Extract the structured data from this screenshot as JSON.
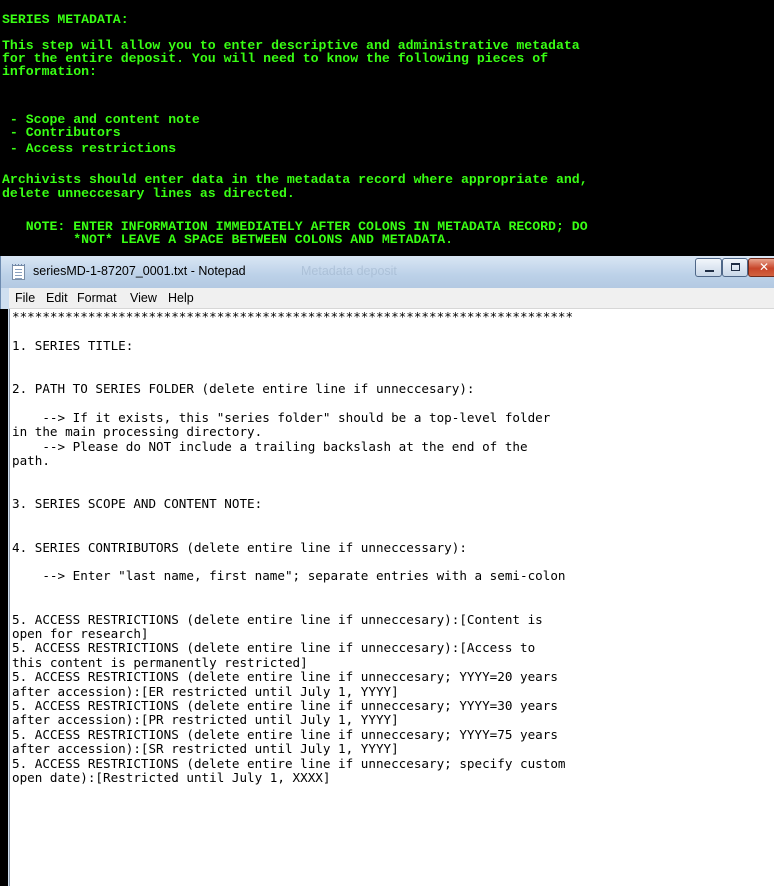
{
  "console": {
    "lines": [
      "SERIES METADATA:",
      "This step will allow you to enter descriptive and administrative metadata",
      "for the entire deposit. You will need to know the following pieces of",
      "information:",
      " - Scope and content note",
      " - Contributors",
      " - Access restrictions",
      "Archivists should enter data in the metadata record where appropriate and,",
      "delete unneccesary lines as directed.",
      "   NOTE: ENTER INFORMATION IMMEDIATELY AFTER COLONS IN METADATA RECORD; DO",
      "         *NOT* LEAVE A SPACE BETWEEN COLONS AND METADATA."
    ]
  },
  "window": {
    "title": "seriesMD-1-87207_0001.txt - Notepad",
    "background_title": "Metadata deposit",
    "colors": {
      "close": "#c7452a",
      "titlebar": "#bcd1e8",
      "console_text": "#39ff14"
    }
  },
  "menu": {
    "file": "File",
    "edit": "Edit",
    "format": "Format",
    "view": "View",
    "help": "Help"
  },
  "editor": {
    "text": "**************************************************************************\n\n1. SERIES TITLE:\n\n\n2. PATH TO SERIES FOLDER (delete entire line if unneccesary):\n\n    --> If it exists, this \"series folder\" should be a top-level folder\nin the main processing directory.\n    --> Please do NOT include a trailing backslash at the end of the\npath.\n\n\n3. SERIES SCOPE AND CONTENT NOTE:\n\n\n4. SERIES CONTRIBUTORS (delete entire line if unneccessary):\n\n    --> Enter \"last name, first name\"; separate entries with a semi-colon\n\n\n5. ACCESS RESTRICTIONS (delete entire line if unneccesary):[Content is\nopen for research]\n5. ACCESS RESTRICTIONS (delete entire line if unneccesary):[Access to\nthis content is permanently restricted]\n5. ACCESS RESTRICTIONS (delete entire line if unneccesary; YYYY=20 years\nafter accession):[ER restricted until July 1, YYYY]\n5. ACCESS RESTRICTIONS (delete entire line if unneccesary; YYYY=30 years\nafter accession):[PR restricted until July 1, YYYY]\n5. ACCESS RESTRICTIONS (delete entire line if unneccesary; YYYY=75 years\nafter accession):[SR restricted until July 1, YYYY]\n5. ACCESS RESTRICTIONS (delete entire line if unneccesary; specify custom\nopen date):[Restricted until July 1, XXXX]"
  }
}
